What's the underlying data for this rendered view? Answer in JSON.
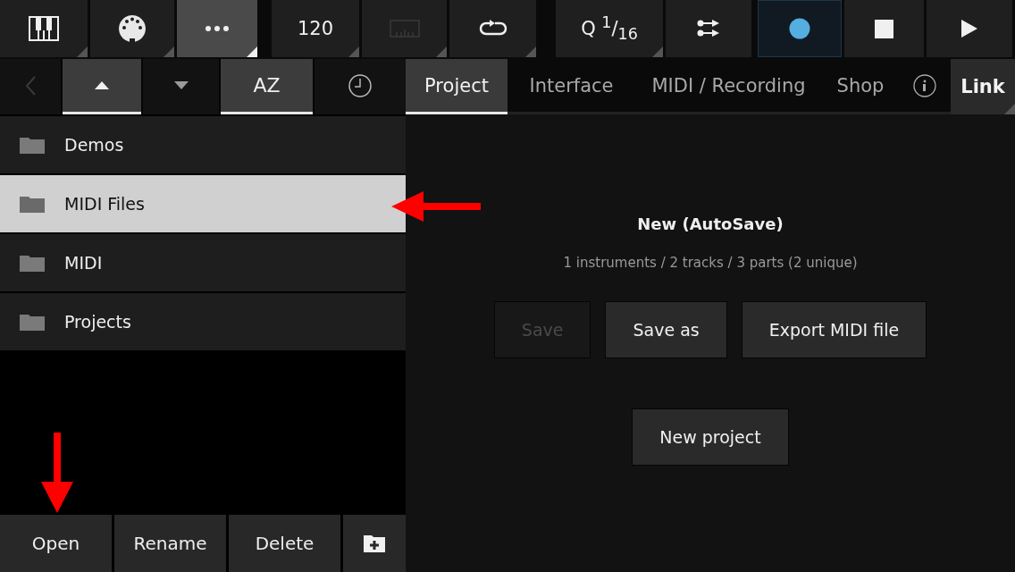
{
  "toolbar": [
    {
      "kind": "piano",
      "selected": false,
      "has_menu": true
    },
    {
      "kind": "midi",
      "selected": false,
      "has_menu": true
    },
    {
      "kind": "more",
      "selected": true,
      "has_menu": true
    },
    {
      "kind": "tempo",
      "label": "120",
      "selected": false,
      "has_menu": true
    },
    {
      "kind": "metronome",
      "selected": false,
      "disabled": true,
      "has_menu": true
    },
    {
      "kind": "loop",
      "selected": false,
      "has_menu": true
    },
    {
      "kind": "quantize",
      "label": "Q $^{1}$/$_{16}$",
      "selected": false,
      "has_menu": true
    },
    {
      "kind": "mixer",
      "selected": false,
      "has_menu": false
    },
    {
      "kind": "record",
      "selected": true,
      "has_menu": false
    },
    {
      "kind": "stop",
      "selected": false,
      "has_menu": false
    },
    {
      "kind": "play",
      "selected": false,
      "has_menu": false
    }
  ],
  "sort_bar": [
    {
      "kind": "back",
      "selected": false,
      "disabled": true
    },
    {
      "kind": "ascending",
      "selected": true
    },
    {
      "kind": "descending",
      "selected": false
    },
    {
      "kind": "alpha",
      "label": "AZ",
      "selected": true
    },
    {
      "kind": "recent",
      "selected": false
    }
  ],
  "files": [
    {
      "name": "Demos",
      "selected": false
    },
    {
      "name": "MIDI Files",
      "selected": true
    },
    {
      "name": "MIDI",
      "selected": false
    },
    {
      "name": "Projects",
      "selected": false
    }
  ],
  "file_actions": [
    {
      "kind": "text",
      "label": "Open"
    },
    {
      "kind": "text",
      "label": "Rename"
    },
    {
      "kind": "text",
      "label": "Delete"
    },
    {
      "kind": "new-folder"
    }
  ],
  "tabs": [
    {
      "label": "Project",
      "selected": true
    },
    {
      "label": "Interface",
      "selected": false
    },
    {
      "label": "MIDI / Recording",
      "selected": false
    },
    {
      "label": "Shop",
      "selected": false
    }
  ],
  "link_button": {
    "label": "Link",
    "has_menu": true
  },
  "project": {
    "title": "New (AutoSave)",
    "summary": "1 instruments / 2 tracks / 3 parts (2 unique)",
    "buttons": [
      {
        "label": "Save",
        "disabled": true
      },
      {
        "label": "Save as",
        "disabled": false
      },
      {
        "label": "Export MIDI file",
        "disabled": false
      }
    ],
    "new_button": "New project"
  }
}
